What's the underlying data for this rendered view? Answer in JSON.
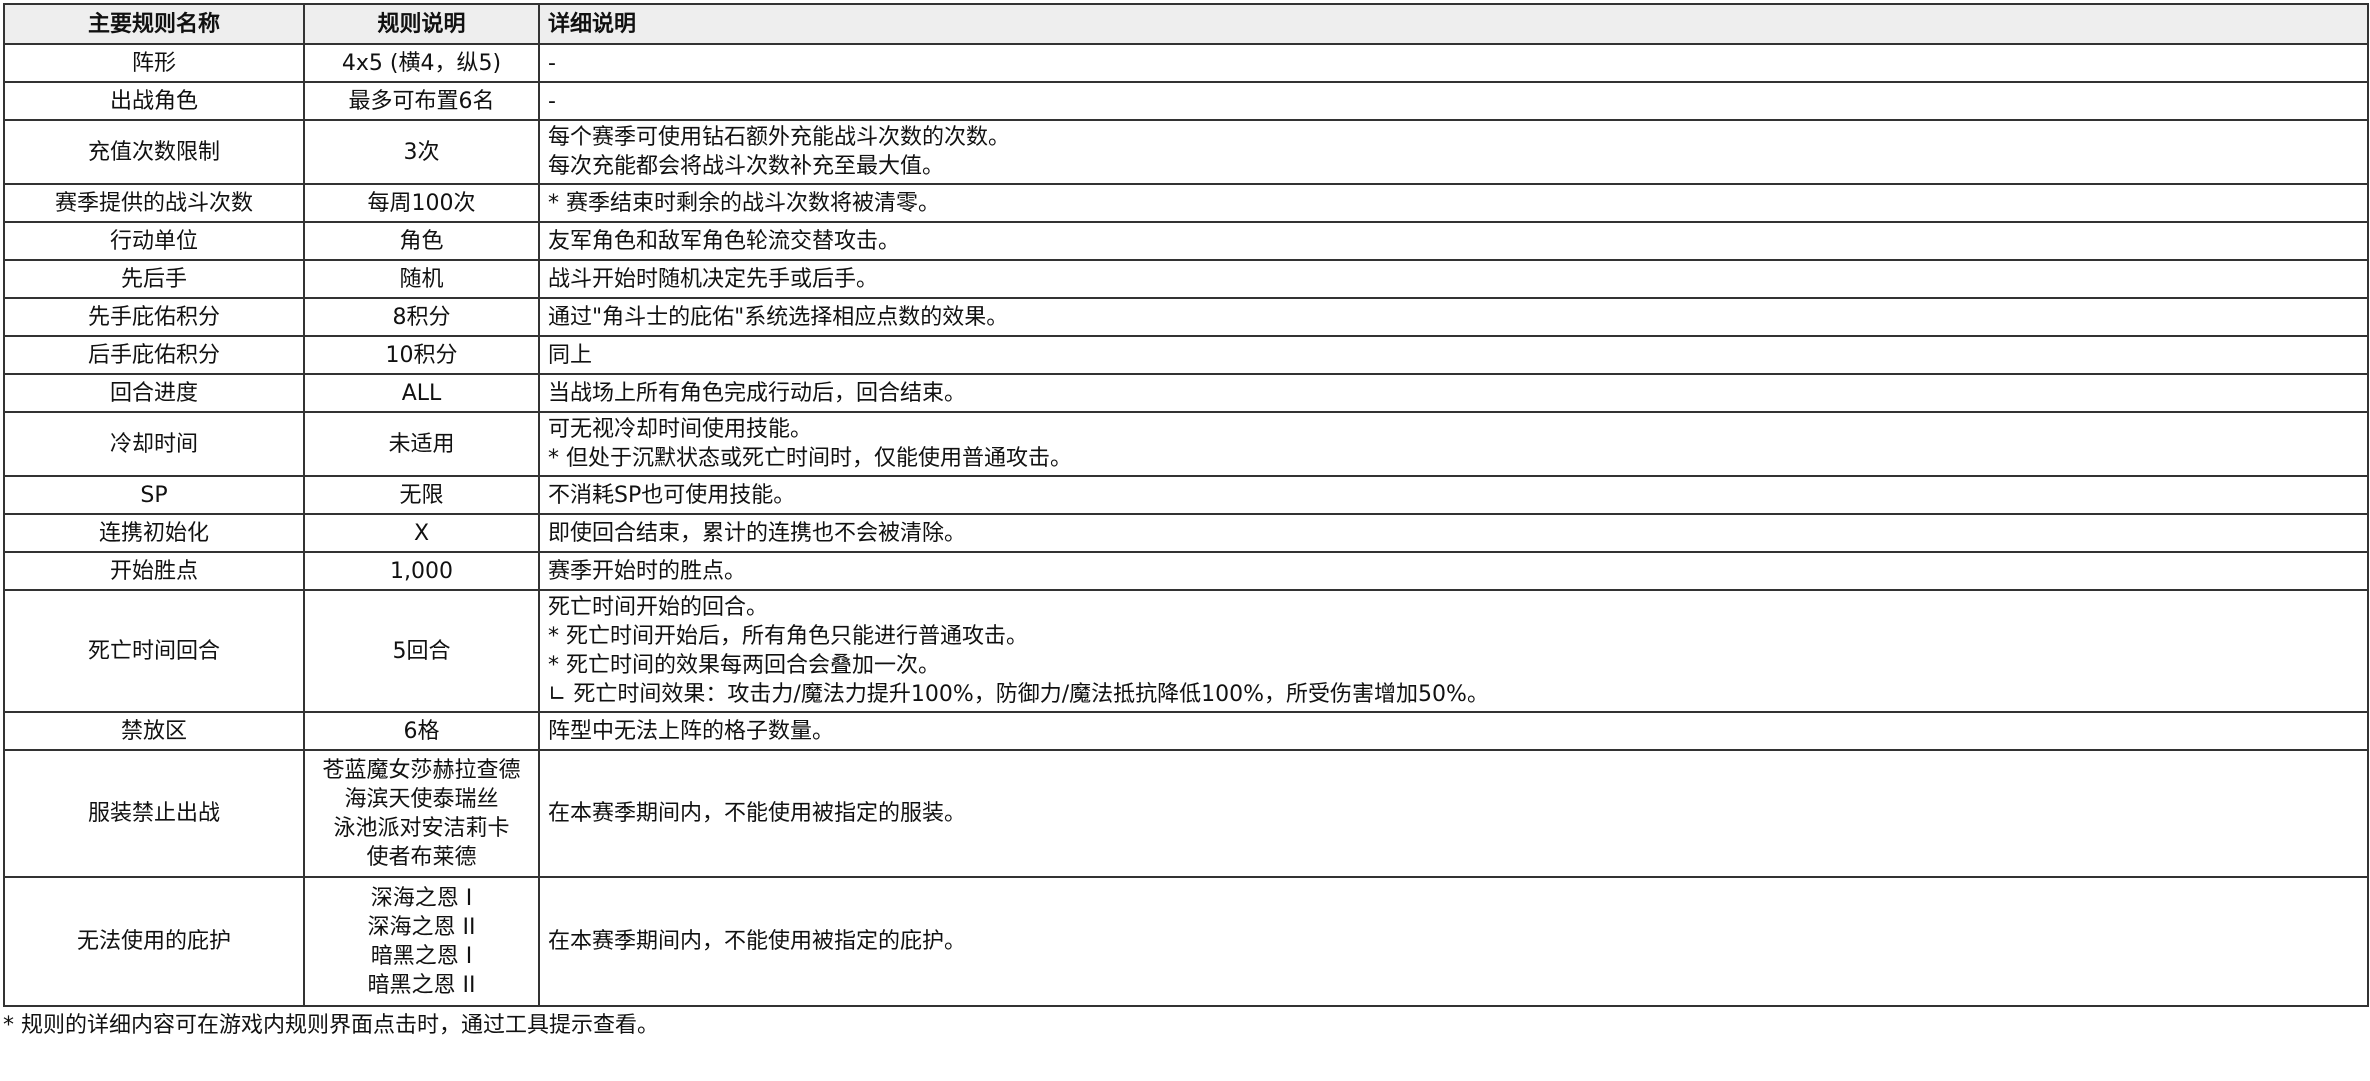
{
  "headers": [
    "主要规则名称",
    "规则说明",
    "详细说明"
  ],
  "rows": [
    {
      "name": "阵形",
      "value": [
        "4x5 (横4，纵5)"
      ],
      "detail": [
        "-"
      ]
    },
    {
      "name": "出战角色",
      "value": [
        "最多可布置6名"
      ],
      "detail": [
        "-"
      ]
    },
    {
      "name": "充值次数限制",
      "value": [
        "3次"
      ],
      "detail": [
        "每个赛季可使用钻石额外充能战斗次数的次数。",
        "每次充能都会将战斗次数补充至最大值。"
      ]
    },
    {
      "name": "赛季提供的战斗次数",
      "value": [
        "每周100次"
      ],
      "detail": [
        "* 赛季结束时剩余的战斗次数将被清零。"
      ]
    },
    {
      "name": "行动单位",
      "value": [
        "角色"
      ],
      "detail": [
        "友军角色和敌军角色轮流交替攻击。"
      ]
    },
    {
      "name": "先后手",
      "value": [
        "随机"
      ],
      "detail": [
        "战斗开始时随机决定先手或后手。"
      ]
    },
    {
      "name": "先手庇佑积分",
      "value": [
        "8积分"
      ],
      "detail": [
        "通过\"角斗士的庇佑\"系统选择相应点数的效果。"
      ]
    },
    {
      "name": "后手庇佑积分",
      "value": [
        "10积分"
      ],
      "detail": [
        "同上"
      ]
    },
    {
      "name": "回合进度",
      "value": [
        "ALL"
      ],
      "detail": [
        "当战场上所有角色完成行动后，回合结束。"
      ]
    },
    {
      "name": "冷却时间",
      "value": [
        "未适用"
      ],
      "detail": [
        "可无视冷却时间使用技能。",
        "* 但处于沉默状态或死亡时间时，仅能使用普通攻击。"
      ]
    },
    {
      "name": "SP",
      "value": [
        "无限"
      ],
      "detail": [
        "不消耗SP也可使用技能。"
      ]
    },
    {
      "name": "连携初始化",
      "value": [
        "X"
      ],
      "detail": [
        "即使回合结束，累计的连携也不会被清除。"
      ]
    },
    {
      "name": "开始胜点",
      "value": [
        "1,000"
      ],
      "detail": [
        "赛季开始时的胜点。"
      ]
    },
    {
      "name": "死亡时间回合",
      "value": [
        "5回合"
      ],
      "detail": [
        "死亡时间开始的回合。",
        "* 死亡时间开始后，所有角色只能进行普通攻击。",
        "* 死亡时间的效果每两回合会叠加一次。",
        "∟ 死亡时间效果：攻击力/魔法力提升100%，防御力/魔法抵抗降低100%，所受伤害增加50%。"
      ]
    },
    {
      "name": "禁放区",
      "value": [
        "6格"
      ],
      "detail": [
        "阵型中无法上阵的格子数量。"
      ]
    },
    {
      "name": "服装禁止出战",
      "value": [
        "苍蓝魔女莎赫拉查德",
        "海滨天使泰瑞丝",
        "泳池派对安洁莉卡",
        "使者布莱德"
      ],
      "detail": [
        "在本赛季期间内，不能使用被指定的服装。"
      ]
    },
    {
      "name": "无法使用的庇护",
      "value": [
        "深海之恩 I",
        "深海之恩 II",
        "暗黑之恩 I",
        "暗黑之恩 II"
      ],
      "detail": [
        "在本赛季期间内，不能使用被指定的庇护。"
      ]
    }
  ],
  "footnote": "* 规则的详细内容可在游戏内规则界面点击时，通过工具提示查看。"
}
